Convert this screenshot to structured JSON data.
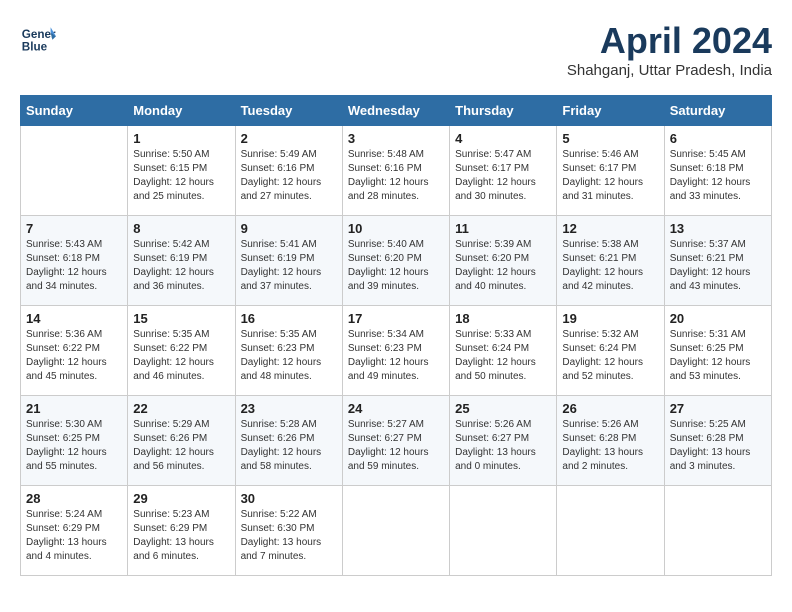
{
  "header": {
    "logo_line1": "General",
    "logo_line2": "Blue",
    "month": "April 2024",
    "location": "Shahganj, Uttar Pradesh, India"
  },
  "columns": [
    "Sunday",
    "Monday",
    "Tuesday",
    "Wednesday",
    "Thursday",
    "Friday",
    "Saturday"
  ],
  "weeks": [
    [
      {
        "day": "",
        "sunrise": "",
        "sunset": "",
        "daylight": ""
      },
      {
        "day": "1",
        "sunrise": "Sunrise: 5:50 AM",
        "sunset": "Sunset: 6:15 PM",
        "daylight": "Daylight: 12 hours and 25 minutes."
      },
      {
        "day": "2",
        "sunrise": "Sunrise: 5:49 AM",
        "sunset": "Sunset: 6:16 PM",
        "daylight": "Daylight: 12 hours and 27 minutes."
      },
      {
        "day": "3",
        "sunrise": "Sunrise: 5:48 AM",
        "sunset": "Sunset: 6:16 PM",
        "daylight": "Daylight: 12 hours and 28 minutes."
      },
      {
        "day": "4",
        "sunrise": "Sunrise: 5:47 AM",
        "sunset": "Sunset: 6:17 PM",
        "daylight": "Daylight: 12 hours and 30 minutes."
      },
      {
        "day": "5",
        "sunrise": "Sunrise: 5:46 AM",
        "sunset": "Sunset: 6:17 PM",
        "daylight": "Daylight: 12 hours and 31 minutes."
      },
      {
        "day": "6",
        "sunrise": "Sunrise: 5:45 AM",
        "sunset": "Sunset: 6:18 PM",
        "daylight": "Daylight: 12 hours and 33 minutes."
      }
    ],
    [
      {
        "day": "7",
        "sunrise": "Sunrise: 5:43 AM",
        "sunset": "Sunset: 6:18 PM",
        "daylight": "Daylight: 12 hours and 34 minutes."
      },
      {
        "day": "8",
        "sunrise": "Sunrise: 5:42 AM",
        "sunset": "Sunset: 6:19 PM",
        "daylight": "Daylight: 12 hours and 36 minutes."
      },
      {
        "day": "9",
        "sunrise": "Sunrise: 5:41 AM",
        "sunset": "Sunset: 6:19 PM",
        "daylight": "Daylight: 12 hours and 37 minutes."
      },
      {
        "day": "10",
        "sunrise": "Sunrise: 5:40 AM",
        "sunset": "Sunset: 6:20 PM",
        "daylight": "Daylight: 12 hours and 39 minutes."
      },
      {
        "day": "11",
        "sunrise": "Sunrise: 5:39 AM",
        "sunset": "Sunset: 6:20 PM",
        "daylight": "Daylight: 12 hours and 40 minutes."
      },
      {
        "day": "12",
        "sunrise": "Sunrise: 5:38 AM",
        "sunset": "Sunset: 6:21 PM",
        "daylight": "Daylight: 12 hours and 42 minutes."
      },
      {
        "day": "13",
        "sunrise": "Sunrise: 5:37 AM",
        "sunset": "Sunset: 6:21 PM",
        "daylight": "Daylight: 12 hours and 43 minutes."
      }
    ],
    [
      {
        "day": "14",
        "sunrise": "Sunrise: 5:36 AM",
        "sunset": "Sunset: 6:22 PM",
        "daylight": "Daylight: 12 hours and 45 minutes."
      },
      {
        "day": "15",
        "sunrise": "Sunrise: 5:35 AM",
        "sunset": "Sunset: 6:22 PM",
        "daylight": "Daylight: 12 hours and 46 minutes."
      },
      {
        "day": "16",
        "sunrise": "Sunrise: 5:35 AM",
        "sunset": "Sunset: 6:23 PM",
        "daylight": "Daylight: 12 hours and 48 minutes."
      },
      {
        "day": "17",
        "sunrise": "Sunrise: 5:34 AM",
        "sunset": "Sunset: 6:23 PM",
        "daylight": "Daylight: 12 hours and 49 minutes."
      },
      {
        "day": "18",
        "sunrise": "Sunrise: 5:33 AM",
        "sunset": "Sunset: 6:24 PM",
        "daylight": "Daylight: 12 hours and 50 minutes."
      },
      {
        "day": "19",
        "sunrise": "Sunrise: 5:32 AM",
        "sunset": "Sunset: 6:24 PM",
        "daylight": "Daylight: 12 hours and 52 minutes."
      },
      {
        "day": "20",
        "sunrise": "Sunrise: 5:31 AM",
        "sunset": "Sunset: 6:25 PM",
        "daylight": "Daylight: 12 hours and 53 minutes."
      }
    ],
    [
      {
        "day": "21",
        "sunrise": "Sunrise: 5:30 AM",
        "sunset": "Sunset: 6:25 PM",
        "daylight": "Daylight: 12 hours and 55 minutes."
      },
      {
        "day": "22",
        "sunrise": "Sunrise: 5:29 AM",
        "sunset": "Sunset: 6:26 PM",
        "daylight": "Daylight: 12 hours and 56 minutes."
      },
      {
        "day": "23",
        "sunrise": "Sunrise: 5:28 AM",
        "sunset": "Sunset: 6:26 PM",
        "daylight": "Daylight: 12 hours and 58 minutes."
      },
      {
        "day": "24",
        "sunrise": "Sunrise: 5:27 AM",
        "sunset": "Sunset: 6:27 PM",
        "daylight": "Daylight: 12 hours and 59 minutes."
      },
      {
        "day": "25",
        "sunrise": "Sunrise: 5:26 AM",
        "sunset": "Sunset: 6:27 PM",
        "daylight": "Daylight: 13 hours and 0 minutes."
      },
      {
        "day": "26",
        "sunrise": "Sunrise: 5:26 AM",
        "sunset": "Sunset: 6:28 PM",
        "daylight": "Daylight: 13 hours and 2 minutes."
      },
      {
        "day": "27",
        "sunrise": "Sunrise: 5:25 AM",
        "sunset": "Sunset: 6:28 PM",
        "daylight": "Daylight: 13 hours and 3 minutes."
      }
    ],
    [
      {
        "day": "28",
        "sunrise": "Sunrise: 5:24 AM",
        "sunset": "Sunset: 6:29 PM",
        "daylight": "Daylight: 13 hours and 4 minutes."
      },
      {
        "day": "29",
        "sunrise": "Sunrise: 5:23 AM",
        "sunset": "Sunset: 6:29 PM",
        "daylight": "Daylight: 13 hours and 6 minutes."
      },
      {
        "day": "30",
        "sunrise": "Sunrise: 5:22 AM",
        "sunset": "Sunset: 6:30 PM",
        "daylight": "Daylight: 13 hours and 7 minutes."
      },
      {
        "day": "",
        "sunrise": "",
        "sunset": "",
        "daylight": ""
      },
      {
        "day": "",
        "sunrise": "",
        "sunset": "",
        "daylight": ""
      },
      {
        "day": "",
        "sunrise": "",
        "sunset": "",
        "daylight": ""
      },
      {
        "day": "",
        "sunrise": "",
        "sunset": "",
        "daylight": ""
      }
    ]
  ]
}
